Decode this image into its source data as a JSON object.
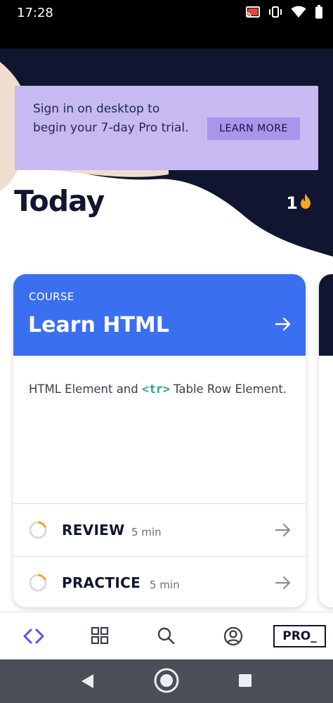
{
  "status_bar": {
    "time": "17:28",
    "icons": [
      "cast-icon",
      "vibrate-icon",
      "wifi-icon",
      "battery-icon"
    ]
  },
  "promo": {
    "text": "Sign in on desktop to begin your 7-day Pro trial.",
    "button_label": "LEARN MORE"
  },
  "header": {
    "title": "Today",
    "streak_count": "1",
    "streak_icon": "flame-icon"
  },
  "course_card": {
    "eyebrow": "COURSE",
    "title": "Learn HTML",
    "description_before": "HTML Element and ",
    "description_code": "<tr>",
    "description_after": " Table Row Element.",
    "tasks": [
      {
        "label": "REVIEW",
        "duration": "5 min"
      },
      {
        "label": "PRACTICE",
        "duration": "5 min"
      }
    ]
  },
  "bottom_nav": {
    "items": [
      "code-icon",
      "catalog-grid-icon",
      "search-icon",
      "profile-icon"
    ],
    "pro_label": "PRO_"
  },
  "colors": {
    "navy": "#10162f",
    "promo_bg": "#c7b9f2",
    "promo_button": "#a996ec",
    "card_header": "#3a6ff0",
    "code_green": "#2ea67c",
    "accent_purple": "#6a49e6",
    "flame": "#f5a623"
  }
}
